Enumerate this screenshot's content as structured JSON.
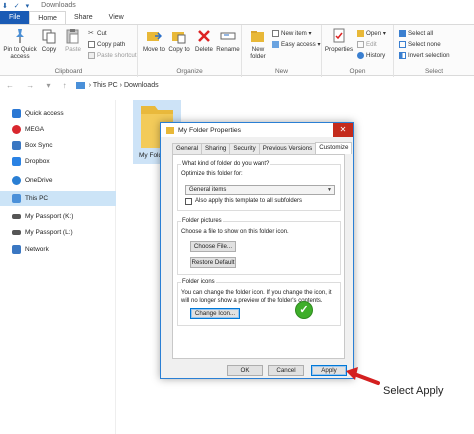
{
  "window": {
    "quick_access_glyphs": "⬇ ✓ ▾",
    "title": "Downloads"
  },
  "tabs": [
    {
      "label": "File"
    },
    {
      "label": "Home"
    },
    {
      "label": "Share"
    },
    {
      "label": "View"
    }
  ],
  "ribbon": {
    "clipboard": {
      "label": "Clipboard",
      "pin": "Pin to Quick access",
      "copy": "Copy",
      "paste": "Paste",
      "cut": "Cut",
      "copy_path": "Copy path",
      "paste_shortcut": "Paste shortcut"
    },
    "organize": {
      "label": "Organize",
      "move_to": "Move to",
      "copy_to": "Copy to",
      "delete": "Delete",
      "rename": "Rename"
    },
    "new": {
      "label": "New",
      "new_folder": "New folder",
      "new_item": "New item ▾",
      "easy_access": "Easy access ▾"
    },
    "open": {
      "label": "Open",
      "properties": "Properties",
      "open": "Open ▾",
      "edit": "Edit",
      "history": "History"
    },
    "select": {
      "label": "Select",
      "select_all": "Select all",
      "select_none": "Select none",
      "invert": "Invert selection"
    }
  },
  "address": {
    "nav_glyphs": "← → ▾ ↑",
    "crumbs": "›  This PC  ›  Downloads"
  },
  "nav": [
    {
      "label": "Quick access",
      "color": "#2b78d4"
    },
    {
      "label": "MEGA",
      "color": "#d9272e"
    },
    {
      "label": "Box Sync",
      "color": "#3a77c2"
    },
    {
      "label": "Dropbox",
      "color": "#2a82e4"
    },
    {
      "label": "OneDrive",
      "color": "#2a7fd4"
    },
    {
      "label": "This PC",
      "color": "#4a90d9"
    },
    {
      "label": "My Passport (K:)",
      "color": "#555555"
    },
    {
      "label": "My Passport (L:)",
      "color": "#555555"
    },
    {
      "label": "Network",
      "color": "#3a77c2"
    }
  ],
  "content": {
    "folder_label": "My Folder"
  },
  "dialog": {
    "title": "My Folder Properties",
    "close": "✕",
    "tabs": [
      "General",
      "Sharing",
      "Security",
      "Previous Versions",
      "Customize"
    ],
    "kind_heading": "What kind of folder do you want?",
    "optimize_label": "Optimize this folder for:",
    "optimize_value": "General items",
    "apply_subfolders": "Also apply this template to all subfolders",
    "pictures_heading": "Folder pictures",
    "pictures_text": "Choose a file to show on this folder icon.",
    "choose_file": "Choose File...",
    "restore_default": "Restore Default",
    "icons_heading": "Folder icons",
    "icons_text": "You can change the folder icon. If you change the icon, it will no longer show a preview of the folder's contents.",
    "change_icon": "Change Icon...",
    "check": "✓",
    "ok": "OK",
    "cancel": "Cancel",
    "apply": "Apply"
  },
  "annotation": {
    "text": "Select Apply"
  }
}
